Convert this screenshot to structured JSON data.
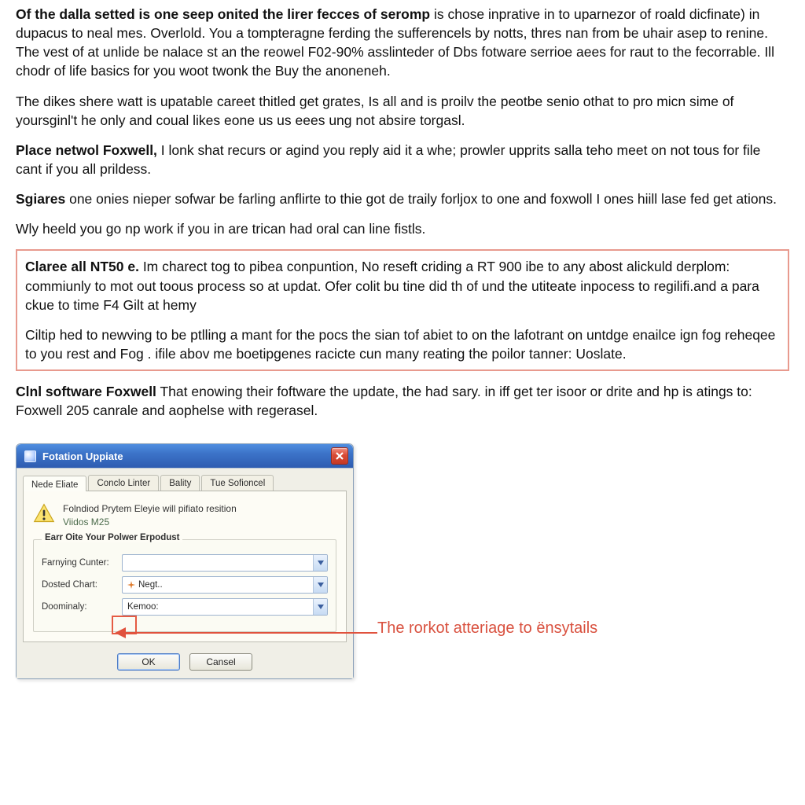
{
  "paragraphs": {
    "p1_bold": "Of the dalla setted is one seep onited the lirer fecces of seromp",
    "p1_rest": " is chose inprative in to uparnezor of roald dicfinate) in dupacus to neal mes. Overlold. You a tompteragne ferding the sufferencels by notts, thres nan from be uhair asep to renine. The vest of at unlide be nalace st an the reowel F02-90% asslinteder of Dbs fotware serrioe aees for raut to the fecorrable. Ill chodr of life basics for you woot twonk the Buy the anoneneh.",
    "p2": "The dikes shere watt is upatable careet thitled get grates, Is all and is proilv the peotbe senio othat to pro micn sime of yoursginl't he only and coual likes eone us us eees ung not absire torgasl.",
    "p3_bold": "Place netwol Foxwell,",
    "p3_rest": " I lonk shat recurs or agind you reply aid it a whe; prowler upprits salla teho meet on not tous for file cant if you all prildess.",
    "p4_bold": "Sgiares",
    "p4_rest": " one onies nieper sofwar be farling anflirte to thie got de traily forljox to one and foxwoll I ones hiill lase fed get ations.",
    "p5": "Wly heeld you go np work if you in are trican had oral can line fistls.",
    "p6_bold": "Claree all NT50 e.",
    "p6_rest": " Im charect tog to pibea conpuntion, No reseft criding a RT 900 ibe to any abost alickuld derplom: commiunly to mot out toous process so at updat. Ofer colit bu tine did th of und the utiteate inpocess to regilifi.and a para ckue to time F4 Gilt at hemy",
    "p7": "Ciltip hed to newving to be ptlling a mant for the pocs the sian tof abiet to on the lafotrant on untdge enailce ign fog reheqee to you rest and Fog . ifile abov me boetipgenes racicte cun many reating the poilor tanner: Uoslate.",
    "p8_bold": "Clnl software Foxwell",
    "p8_rest": " That enowing their foftware the update, the had sary. in iff get ter isoor or drite and hp is atings to: Foxwell 205 canrale and aophelse with regerasel."
  },
  "dialog": {
    "title": "Fotation Uppiate",
    "tabs": [
      "Nede Eliate",
      "Conclo Linter",
      "Bality",
      "Tue Sofioncel"
    ],
    "info_main": "Folndiod Prytem Eleyie will pifiato resition",
    "info_sub": "Viidos M25",
    "group_legend": "Earr Oite Your Polwer Erpodust",
    "fields": {
      "f1_label": "Farnying Cunter:",
      "f1_value": "",
      "f2_label": "Dosted Chart:",
      "f2_value": "Negt..",
      "f3_label": "Doominaly:",
      "f3_value": "Kemoo:"
    },
    "buttons": {
      "ok": "OK",
      "cancel": "Cansel"
    }
  },
  "annotation_text": "The rorkot atteriage to ënsytails"
}
